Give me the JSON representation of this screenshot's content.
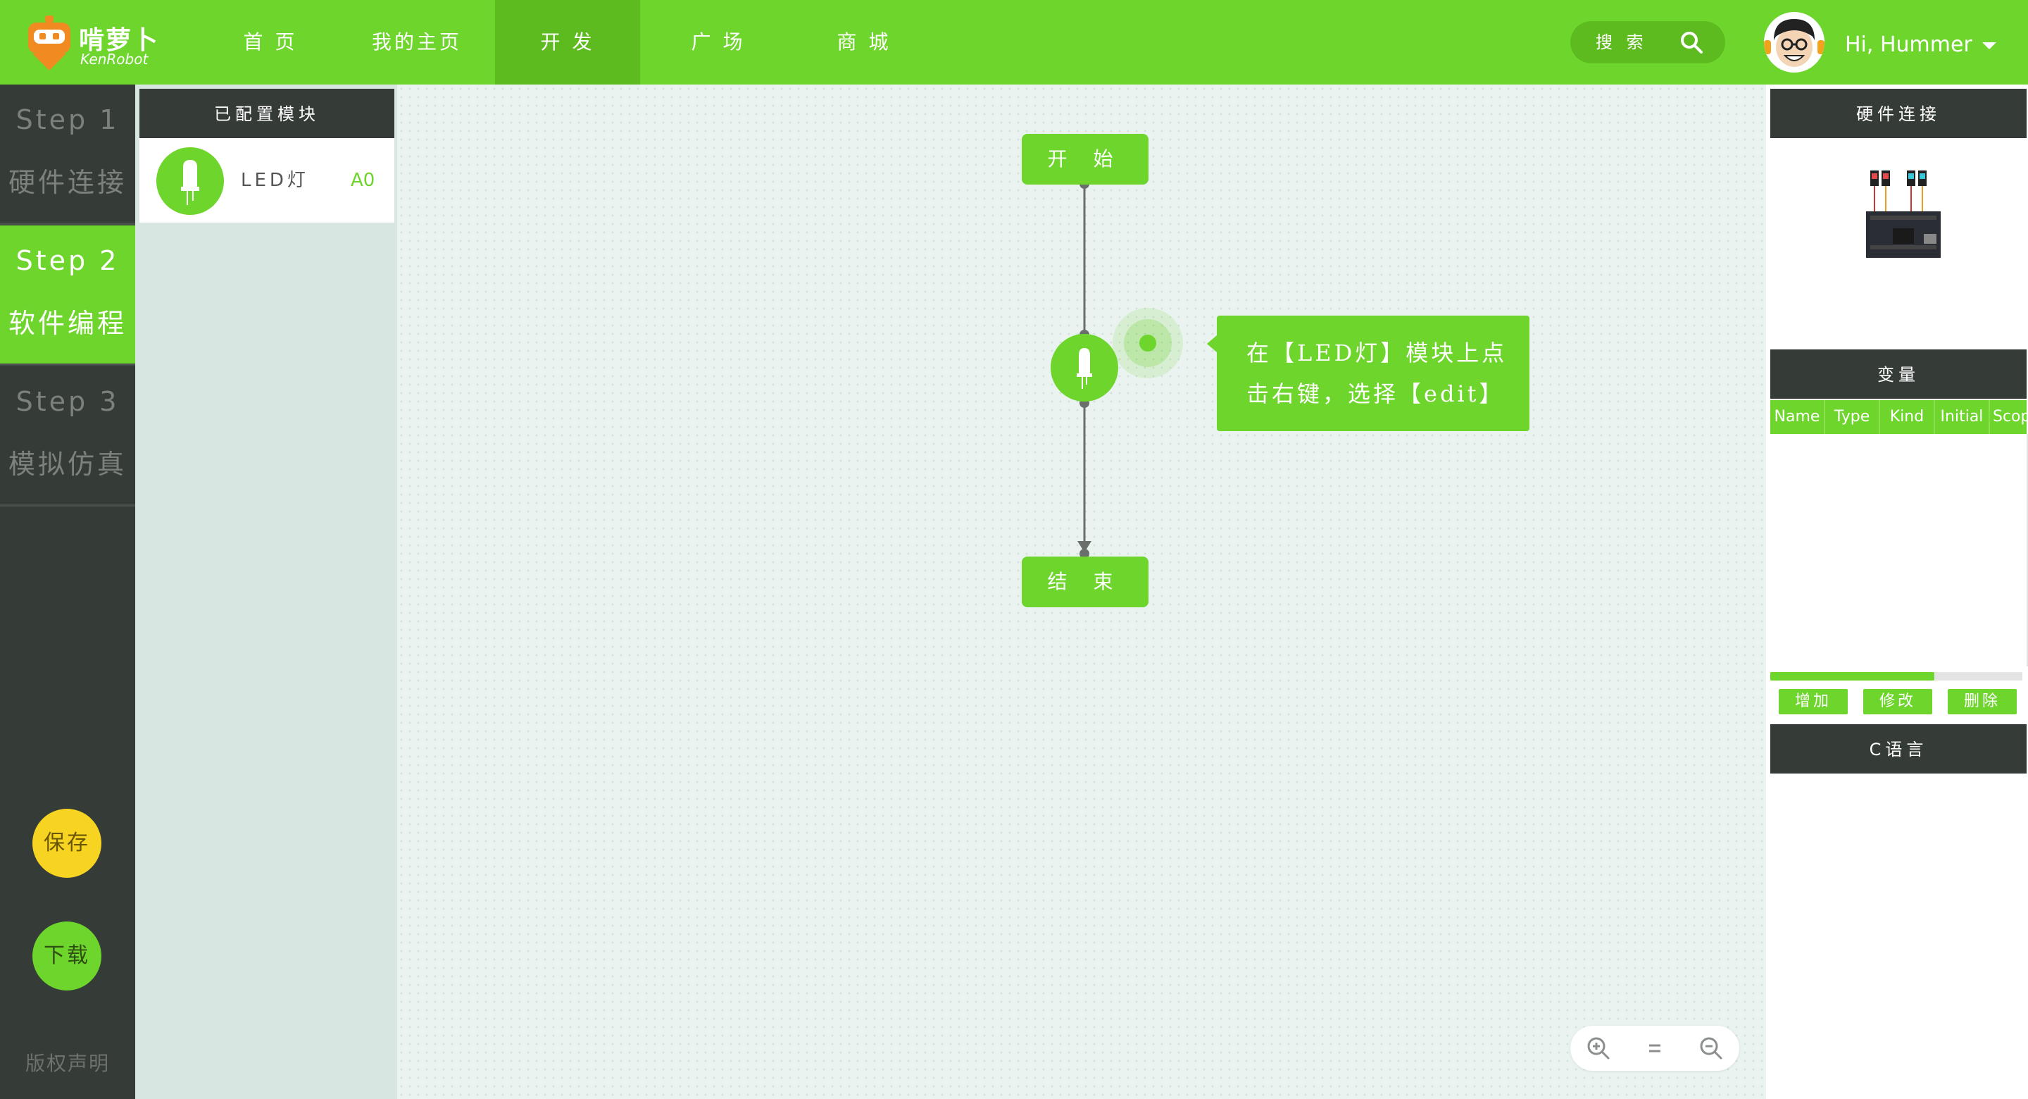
{
  "header": {
    "brand_cn": "啃萝卜",
    "brand_en": "KenRobot",
    "nav": [
      {
        "label": "首 页",
        "active": false
      },
      {
        "label": "我的主页",
        "active": false
      },
      {
        "label": "开 发",
        "active": true
      },
      {
        "label": "广 场",
        "active": false
      },
      {
        "label": "商 城",
        "active": false
      }
    ],
    "search_label": "搜 索",
    "greeting": "Hi,  Hummer"
  },
  "steps": [
    {
      "number": "Step 1",
      "title": "硬件连接",
      "active": false
    },
    {
      "number": "Step 2",
      "title": "软件编程",
      "active": true
    },
    {
      "number": "Step 3",
      "title": "模拟仿真",
      "active": false
    }
  ],
  "actions": {
    "save": "保存",
    "download": "下载",
    "copyright": "版权声明"
  },
  "modules": {
    "header": "已配置模块",
    "items": [
      {
        "name": "LED灯",
        "port": "A0"
      }
    ]
  },
  "flow": {
    "start": "开 始",
    "end": "结 束",
    "tooltip_line1": "在【LED灯】模块上点",
    "tooltip_line2": "击右键，选择【edit】"
  },
  "right_panel": {
    "hardware_header": "硬件连接",
    "variables_header": "变量",
    "columns": [
      "Name",
      "Type",
      "Kind",
      "Initial",
      "Scope"
    ],
    "rows": [],
    "scroll_fraction": 0.65,
    "buttons": {
      "add": "增加",
      "edit": "修改",
      "delete": "删除"
    },
    "c_header": "C语言"
  },
  "colors": {
    "brand_green": "#6dd52b",
    "dark": "#353b37",
    "save_yellow": "#f7d421"
  },
  "icons": {
    "search": "search-icon",
    "zoom_in": "zoom-in-icon",
    "zoom_reset": "zoom-reset-icon",
    "zoom_out": "zoom-out-icon",
    "caret": "caret-down-icon"
  }
}
